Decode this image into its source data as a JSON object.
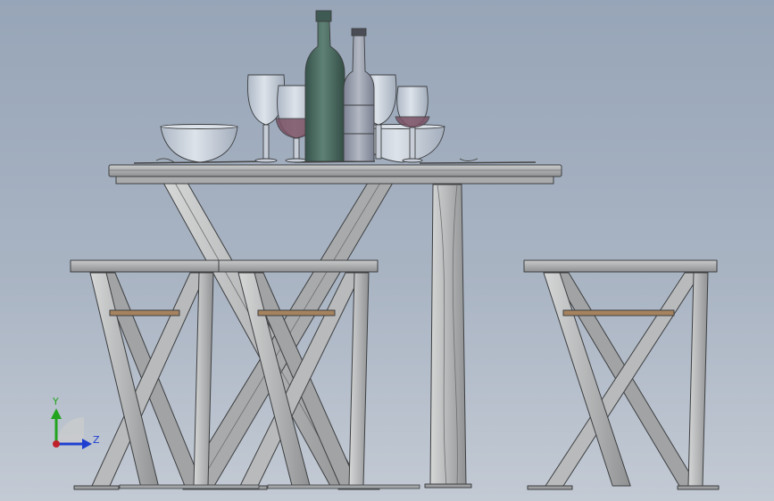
{
  "viewport": {
    "background_top": "#97a5b8",
    "background_bottom": "#c3cad4"
  },
  "triad": {
    "y_label": "Y",
    "z_label": "Z",
    "y_color": "#22a41e",
    "z_color": "#1f3fd0",
    "origin_color": "#c0202a"
  },
  "colors": {
    "metal_fill": "#b3b5b6",
    "metal_light": "#d0d1d1",
    "metal_dark": "#7f8182",
    "edge": "#3d3f41",
    "wood": "#a5835e",
    "bottle_green": "#4f6e62",
    "bottle_gray": "#9aa0ad",
    "glass": "#c8d0da",
    "wine": "#7a5064"
  }
}
